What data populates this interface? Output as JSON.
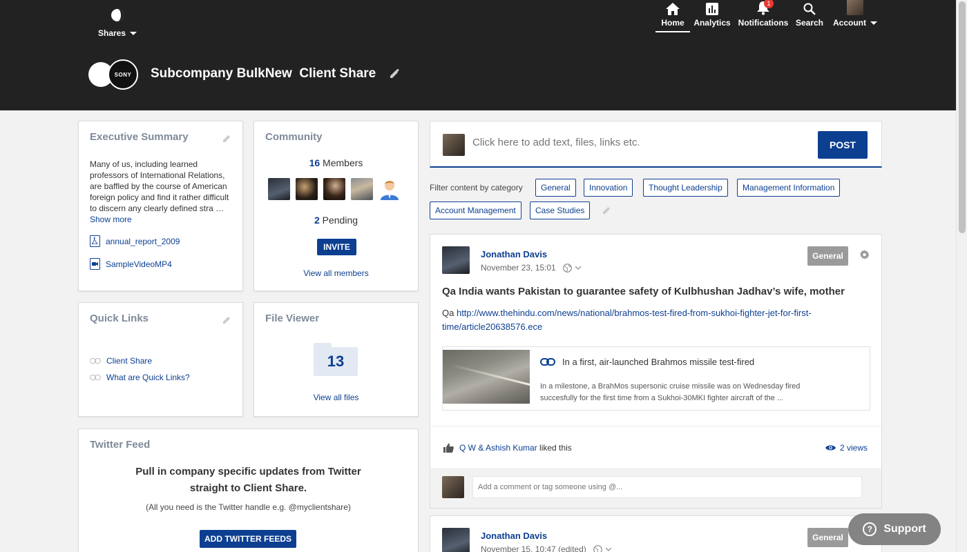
{
  "header": {
    "shares_label": "Shares",
    "share_title": "Subcompany BulkNew  Client Share",
    "sony_logo_text": "SONY",
    "nav": {
      "home": "Home",
      "analytics": "Analytics",
      "notifications": "Notifications",
      "notifications_badge": "1",
      "search": "Search",
      "account": "Account"
    }
  },
  "executive_summary": {
    "title": "Executive Summary",
    "text": "Many of us, including learned professors of International Relations, are baffled by the course of American foreign policy and find it rather difficult to discern any clearly defined stra … ",
    "show_more": "Show more",
    "files": [
      "annual_report_2009",
      "SampleVideoMP4"
    ]
  },
  "community": {
    "title": "Community",
    "members_count": "16",
    "members_label": " Members",
    "pending_count": "2",
    "pending_label": " Pending",
    "invite_label": "INVITE",
    "view_all": "View all members"
  },
  "quick_links": {
    "title": "Quick Links",
    "links": [
      "Client Share",
      "What are Quick Links?"
    ]
  },
  "file_viewer": {
    "title": "File Viewer",
    "count": "13",
    "view_all": "View all files"
  },
  "twitter_feed": {
    "title": "Twitter Feed",
    "headline_line1": "Pull in company specific updates from Twitter",
    "headline_line2": "straight to Client Share.",
    "subtext": "(All you need is the Twitter handle e.g. @myclientshare)",
    "button_label": "ADD TWITTER FEEDS"
  },
  "composer": {
    "placeholder": "Click here to add text, files, links etc.",
    "post_label": "POST"
  },
  "filter": {
    "label": "Filter content by category",
    "categories": [
      "General",
      "Innovation",
      "Thought Leadership",
      "Management Information",
      "Account Management",
      "Case Studies"
    ]
  },
  "posts": [
    {
      "author": "Jonathan Davis",
      "date": "November 23, 15:01",
      "category": "General",
      "title": "Qa India wants Pakistan to guarantee safety of Kulbhushan Jadhav’s wife, mother",
      "body_prefix": "Qa ",
      "link": "http://www.thehindu.com/news/national/brahmos-test-fired-from-sukhoi-fighter-jet-for-first-time/article20638576.ece",
      "preview_title": "In a first, air-launched Brahmos missile test-fired",
      "preview_desc": "In a milestone, a BrahMos supersonic cruise missile was on Wednesday fired succesfully for the first time from a Sukhoi-30MKI fighter aircraft of the ...",
      "likers": "Q W & Ashish Kumar",
      "liked_suffix": "liked this",
      "views": "2 views",
      "comment_placeholder": "Add a comment or tag someone using @..."
    },
    {
      "author": "Jonathan Davis",
      "date": "November 15, 10:47 (edited)",
      "category": "General"
    }
  ],
  "support": {
    "label": "Support"
  },
  "colors": {
    "header_bg": "#222222",
    "brand_blue": "#0d3f91",
    "tag_gray": "#9a9a9a",
    "badge_red": "#e53935"
  }
}
